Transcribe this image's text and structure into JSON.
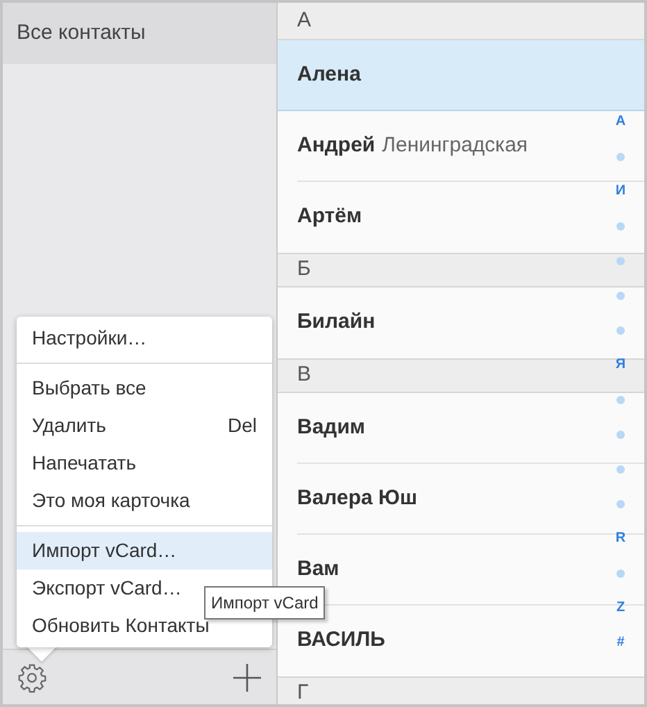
{
  "sidebar": {
    "title": "Все контакты"
  },
  "menu": {
    "items": [
      {
        "kind": "item",
        "label": "Настройки…",
        "selected": false
      },
      {
        "kind": "separator"
      },
      {
        "kind": "item",
        "label": "Выбрать все",
        "selected": false
      },
      {
        "kind": "item",
        "label": "Удалить",
        "shortcut": "Del",
        "selected": false
      },
      {
        "kind": "item",
        "label": "Напечатать",
        "selected": false
      },
      {
        "kind": "item",
        "label": "Это моя карточка",
        "selected": false
      },
      {
        "kind": "separator"
      },
      {
        "kind": "item",
        "label": "Импорт vCard…",
        "selected": true
      },
      {
        "kind": "item",
        "label": "Экспорт vCard…",
        "selected": false
      },
      {
        "kind": "item",
        "label": "Обновить Контакты",
        "selected": false
      }
    ]
  },
  "tooltip": {
    "text": "Импорт vCard"
  },
  "contacts": {
    "sections": [
      {
        "letter": "А",
        "rows": [
          {
            "name": "Алена",
            "selected": true
          },
          {
            "name": "Андрей",
            "detail": "Ленинградская",
            "selected": false
          },
          {
            "name": "Артём",
            "selected": false
          }
        ]
      },
      {
        "letter": "Б",
        "rows": [
          {
            "name": "Билайн",
            "selected": false
          }
        ]
      },
      {
        "letter": "В",
        "rows": [
          {
            "name": "Вадим",
            "selected": false
          },
          {
            "name": "Валера Юш",
            "selected": false
          },
          {
            "name": "Вам",
            "selected": false
          },
          {
            "name": "ВАСИЛЬ",
            "selected": false
          }
        ]
      },
      {
        "letter": "Г"
      }
    ]
  },
  "index": [
    {
      "kind": "letter",
      "label": "А"
    },
    {
      "kind": "dot"
    },
    {
      "kind": "letter",
      "label": "И"
    },
    {
      "kind": "dot"
    },
    {
      "kind": "dot"
    },
    {
      "kind": "dot"
    },
    {
      "kind": "dot"
    },
    {
      "kind": "letter",
      "label": "Я"
    },
    {
      "kind": "dot"
    },
    {
      "kind": "dot"
    },
    {
      "kind": "dot"
    },
    {
      "kind": "dot"
    },
    {
      "kind": "letter",
      "label": "R"
    },
    {
      "kind": "dot"
    },
    {
      "kind": "letter",
      "label": "Z"
    },
    {
      "kind": "letter",
      "label": "#"
    }
  ]
}
